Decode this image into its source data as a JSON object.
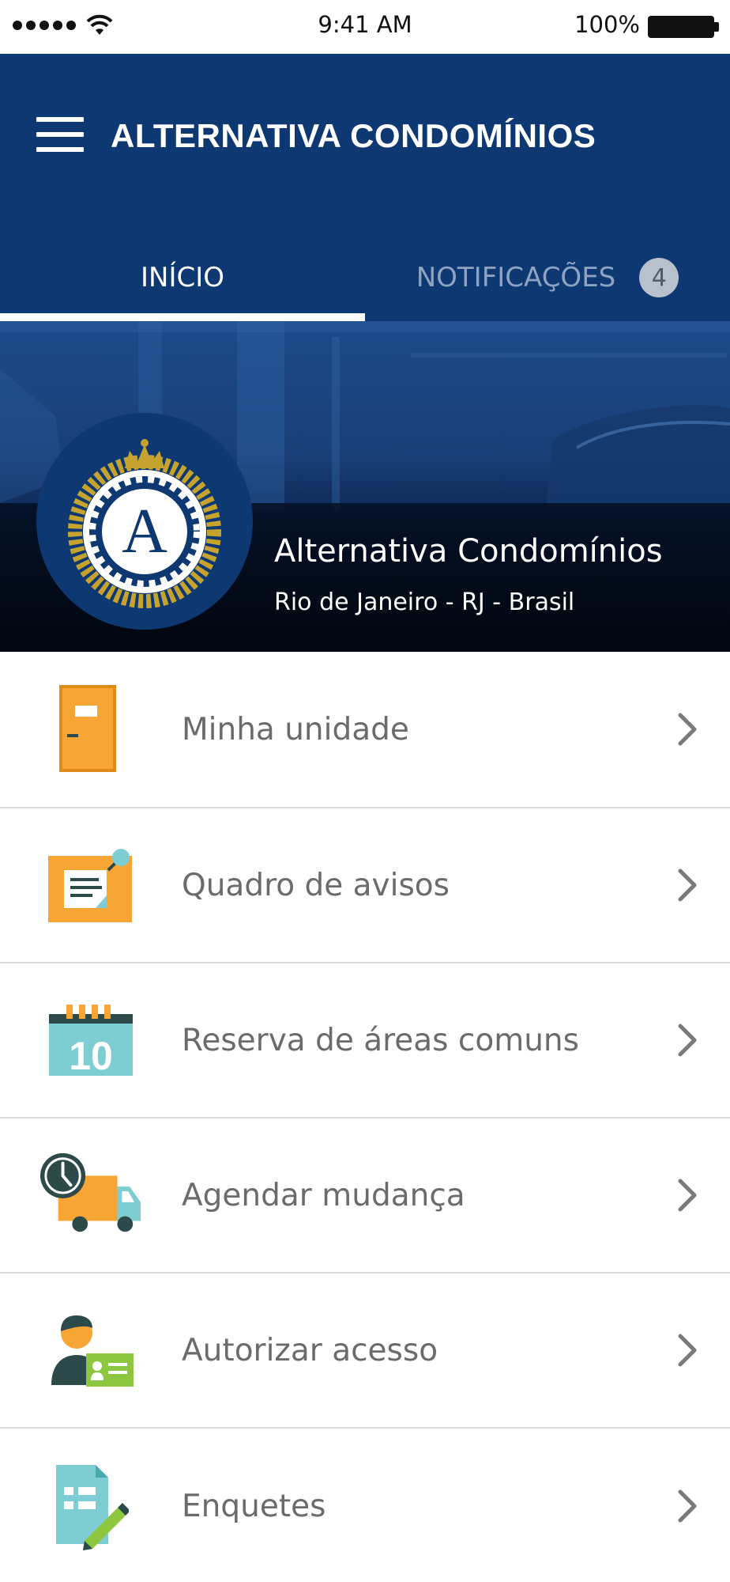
{
  "status_bar": {
    "time": "9:41 AM",
    "battery_percent": "100%",
    "signal_dots": 5
  },
  "header": {
    "title": "ALTERNATIVA CONDOMÍNIOS",
    "menu_icon": "hamburger-menu-icon"
  },
  "tabs": [
    {
      "label": "INÍCIO",
      "active": true
    },
    {
      "label": "NOTIFICAÇÕES",
      "active": false,
      "badge": "4"
    }
  ],
  "banner": {
    "name": "Alternativa Condomínios",
    "location": "Rio de Janeiro - RJ - Brasil",
    "logo_letter": "A"
  },
  "menu_items": [
    {
      "label": "Minha unidade",
      "icon": "door-icon"
    },
    {
      "label": "Quadro de avisos",
      "icon": "notice-board-icon"
    },
    {
      "label": "Reserva de áreas comuns",
      "icon": "calendar-icon",
      "icon_text": "10"
    },
    {
      "label": "Agendar mudança",
      "icon": "moving-truck-icon"
    },
    {
      "label": "Autorizar acesso",
      "icon": "access-card-icon"
    },
    {
      "label": "Enquetes",
      "icon": "poll-icon"
    }
  ],
  "colors": {
    "header_bg": "#0d3872",
    "accent_orange": "#f7a535",
    "accent_teal": "#7ecdd2",
    "accent_dark_green": "#2d4a4a",
    "accent_green": "#8dc63f",
    "logo_gold": "#c6a32e"
  }
}
